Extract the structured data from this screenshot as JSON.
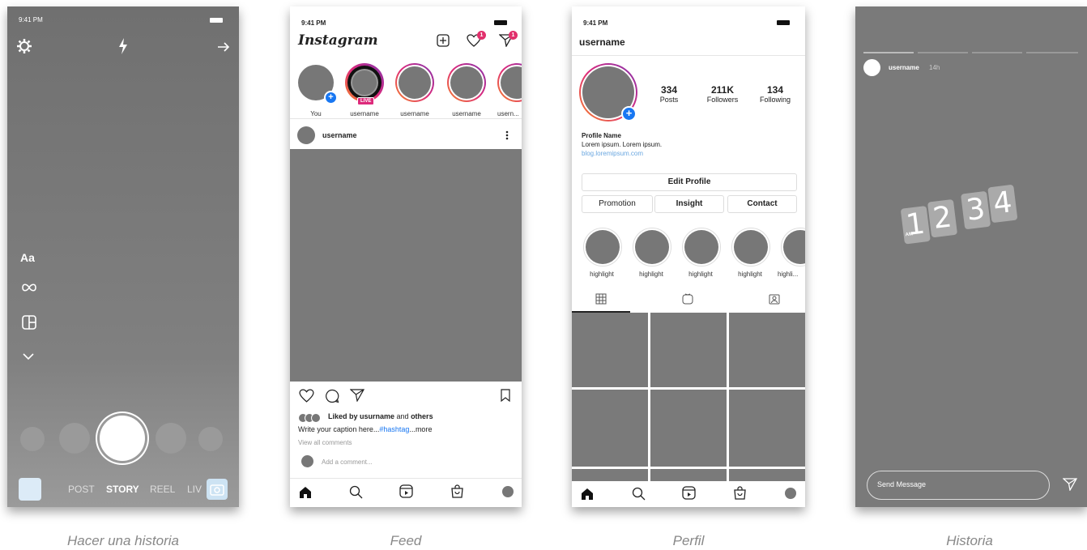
{
  "captions": [
    "Hacer una historia",
    "Feed",
    "Perfil",
    "Historia"
  ],
  "camera": {
    "time": "9:41 PM",
    "side_text": "Aa",
    "modes": [
      "POST",
      "STORY",
      "REEL",
      "LIV"
    ],
    "active_mode": "STORY"
  },
  "feed": {
    "time": "9:41 PM",
    "logo": "Instagram",
    "likes_badge": "1",
    "dm_badge": "1",
    "stories": [
      {
        "label": "You"
      },
      {
        "label": "username",
        "live": "LIVE"
      },
      {
        "label": "username"
      },
      {
        "label": "username"
      },
      {
        "label": "usern..."
      }
    ],
    "post_username": "username",
    "liked_prefix": "Liked by ",
    "liked_user": "usurname",
    "liked_mid": " and ",
    "liked_others": "others",
    "caption_text": "Write your caption here...",
    "caption_hashtag": "#hashtag",
    "caption_more": "...more",
    "view_comments": "View all comments",
    "add_comment": "Add a comment..."
  },
  "profile": {
    "time": "9:41 PM",
    "username": "username",
    "stats": [
      {
        "value": "334",
        "label": "Posts"
      },
      {
        "value": "211K",
        "label": "Followers"
      },
      {
        "value": "134",
        "label": "Following"
      }
    ],
    "name": "Profile Name",
    "bio": "Lorem ipsum. Lorem ipsum.",
    "link": "blog.loremipsum.com",
    "edit_button": "Edit Profile",
    "buttons": [
      "Promotion",
      "Insight",
      "Contact"
    ],
    "highlights": [
      "highlight",
      "highlight",
      "highlight",
      "highlight",
      "highli..."
    ]
  },
  "story": {
    "username": "username",
    "age": "14h",
    "clock_digits": [
      "1",
      "2",
      "3",
      "4"
    ],
    "clock_ampm": "AM",
    "message_placeholder": "Send Message"
  },
  "colors": {
    "screen_gray": "#7a7a7a",
    "accent_blue": "#1877f2",
    "notification_red": "#e1306c",
    "link_blue": "#6aa7e0"
  }
}
